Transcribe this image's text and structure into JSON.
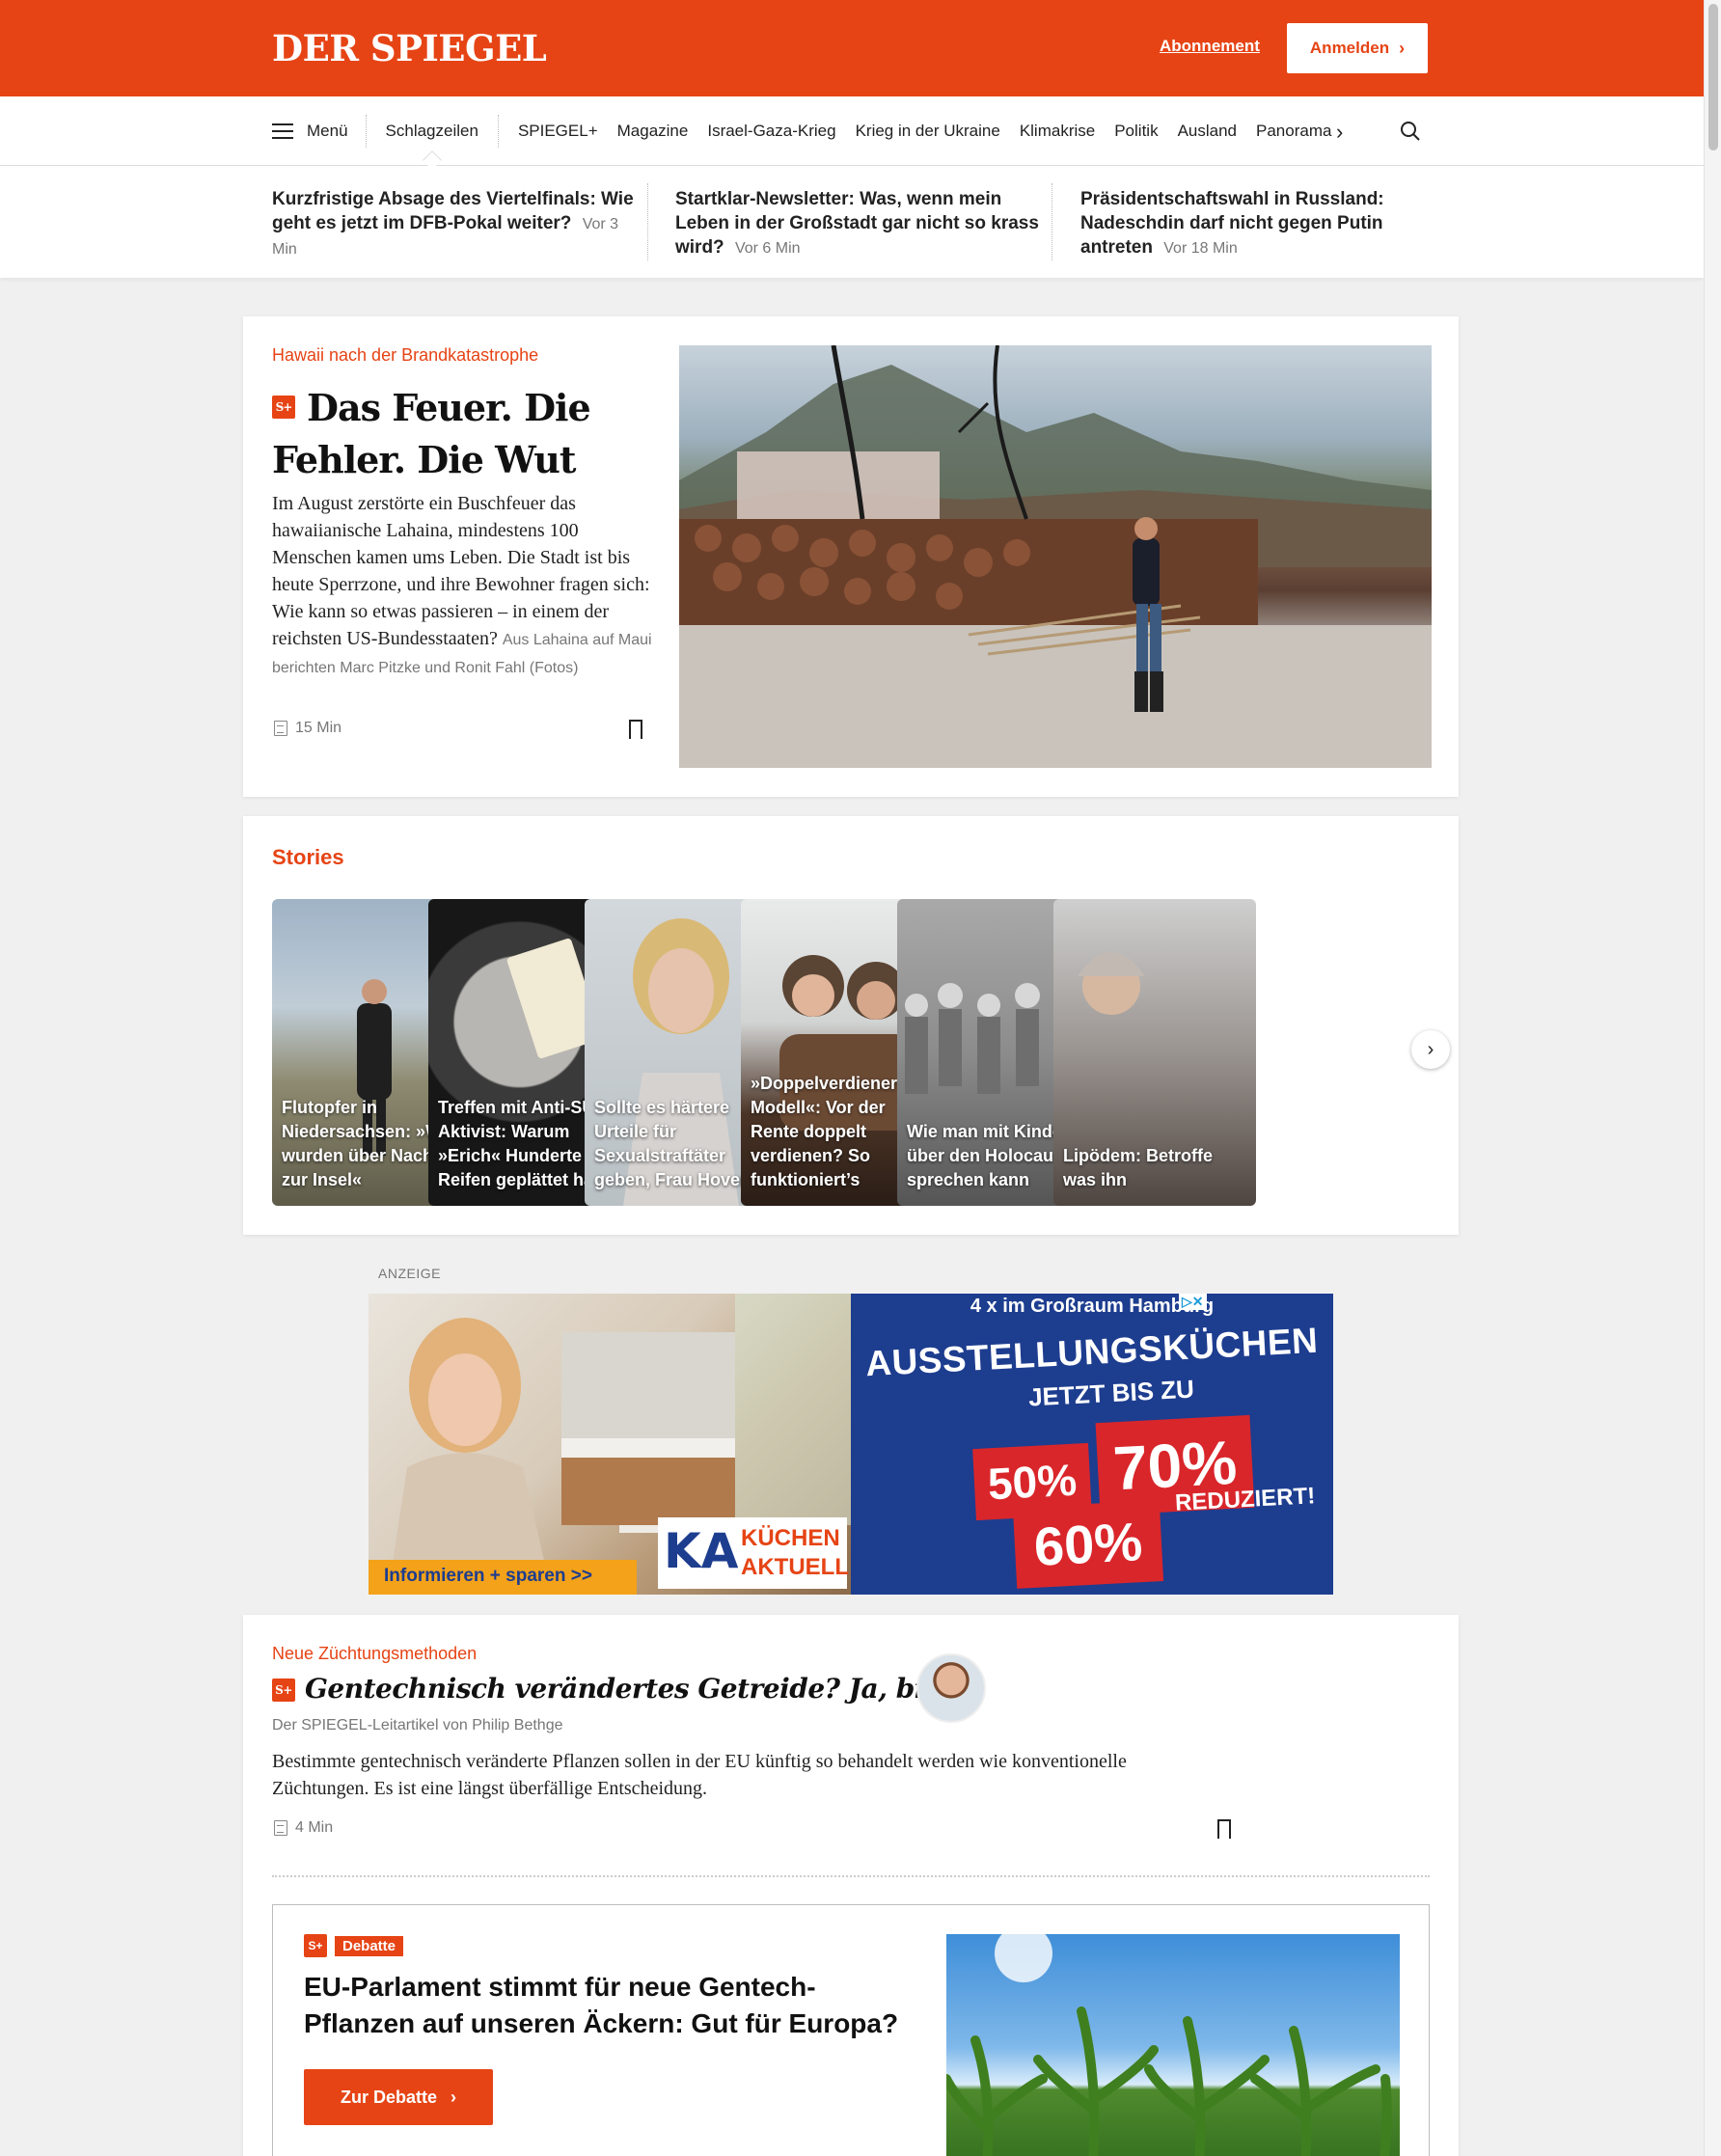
{
  "header": {
    "logo": "DER SPIEGEL",
    "abonnement": "Abonnement",
    "anmelden": "Anmelden",
    "brand_color": "#e64415"
  },
  "nav": {
    "menu_label": "Menü",
    "items": [
      "Schlagzeilen",
      "SPIEGEL+",
      "Magazine",
      "Israel-Gaza-Krieg",
      "Krieg in der Ukraine",
      "Klimakrise",
      "Politik",
      "Ausland",
      "Panorama"
    ],
    "next_icon": "chevron-right-icon",
    "search_icon": "search-icon"
  },
  "breaking": [
    {
      "title": "Kurzfristige Absage des Viertelfinals: Wie geht es jetzt im DFB-Pokal weiter?",
      "time": "Vor 3 Min"
    },
    {
      "title": "Startklar-Newsletter: Was, wenn mein Leben in der Großstadt gar nicht so krass wird?",
      "time": "Vor 6 Min"
    },
    {
      "title": "Präsidentschaftswahl in Russland: Nadeschdin darf nicht gegen Putin antreten",
      "time": "Vor 18 Min"
    }
  ],
  "hero": {
    "kicker": "Hawaii nach der Brandkatastrophe",
    "title": "Das Feuer. Die Fehler. Die Wut",
    "text": "Im August zerstörte ein Buschfeuer das hawaiianische Lahaina, mindestens 100 Menschen kamen ums Leben. Die Stadt ist bis heute Sperrzone, und ihre Bewohner fragen sich: Wie kann so etwas passieren – in einem der reichsten US-Bundesstaaten?",
    "author": "Aus Lahaina auf Maui berichten Marc Pitzke und Ronit Fahl (Fotos)",
    "reading_time": "15 Min",
    "splus": "S+"
  },
  "stories": {
    "title": "Stories",
    "items": [
      "Flutopfer in Niedersachsen: »Wir wurden über Nacht zur Insel«",
      "Treffen mit Anti-SUV-Aktivist: Warum »Erich« Hunderte Reifen geplättet hat",
      "Sollte es härtere Urteile für Sexualstraftäter geben, Frau Hoven?",
      "»Doppelverdiener-Modell«: Vor der Rente doppelt verdienen? So funktioniert’s",
      "Wie man mit Kindern über den Holocaust sprechen kann",
      "Lipödem: Betroffe was ihn"
    ]
  },
  "ad": {
    "label": "ANZEIGE",
    "headline_top": "4 x im Großraum Hamburg",
    "headline_main": "AUSSTELLUNGSKÜCHEN",
    "sub": "JETZT BIS ZU",
    "pct_1": "50%",
    "pct_2": "70%",
    "pct_3": "60%",
    "reduziert": "REDUZIERT!",
    "cta": "Informieren + sparen >>",
    "logo_1": "KÜCHEN",
    "logo_2": "AKTUELL",
    "logo_ka": "KA",
    "adchoices": "▷✕"
  },
  "editorial": {
    "kicker": "Neue Züchtungsmethoden",
    "title": "Gentechnisch verändertes Getreide? Ja, bitte!",
    "author": "Der SPIEGEL-Leitartikel von Philip Bethge",
    "text": "Bestimmte gentechnisch veränderte Pflanzen sollen in der EU künftig so behandelt werden wie konventionelle Züchtungen. Es ist eine längst überfällige Entscheidung.",
    "reading_time": "4 Min",
    "splus": "S+"
  },
  "debate": {
    "tag": "Debatte",
    "splus": "S+",
    "title": "EU-Parlament stimmt für neue Gentech-Pflanzen auf unseren Äckern: Gut für Europa?",
    "button": "Zur Debatte"
  }
}
